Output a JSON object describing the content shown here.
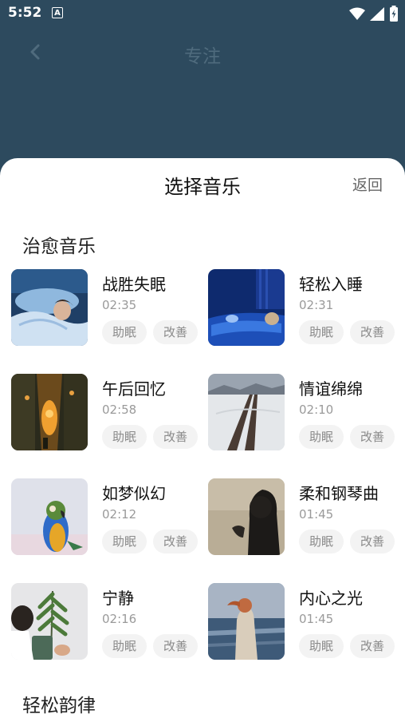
{
  "status": {
    "time": "5:52",
    "notif_badge": "A"
  },
  "header": {
    "title": "专注"
  },
  "sheet": {
    "title": "选择音乐",
    "back_label": "返回",
    "sections": [
      {
        "title": "治愈音乐",
        "tracks": [
          {
            "name": "战胜失眠",
            "duration": "02:35",
            "tags": [
              "助眠",
              "改善"
            ],
            "image": "person-in-bed"
          },
          {
            "name": "轻松入睡",
            "duration": "02:31",
            "tags": [
              "助眠",
              "改善"
            ],
            "image": "sleeping-blue-room"
          },
          {
            "name": "午后回忆",
            "duration": "02:58",
            "tags": [
              "助眠",
              "改善"
            ],
            "image": "lantern-alley"
          },
          {
            "name": "情谊绵绵",
            "duration": "02:10",
            "tags": [
              "助眠",
              "改善"
            ],
            "image": "snowy-road"
          },
          {
            "name": "如梦似幻",
            "duration": "02:12",
            "tags": [
              "助眠",
              "改善"
            ],
            "image": "parrot"
          },
          {
            "name": "柔和钢琴曲",
            "duration": "01:45",
            "tags": [
              "助眠",
              "改善"
            ],
            "image": "hooded-silhouette"
          },
          {
            "name": "宁静",
            "duration": "02:16",
            "tags": [
              "助眠",
              "改善"
            ],
            "image": "potted-plant"
          },
          {
            "name": "内心之光",
            "duration": "01:45",
            "tags": [
              "助眠",
              "改善"
            ],
            "image": "woman-at-sea"
          }
        ]
      },
      {
        "title": "轻松韵律",
        "tracks": []
      }
    ]
  },
  "colors": {
    "backdrop": "#2d4a5e",
    "sheet": "#ffffff",
    "tag_bg": "#f3f3f3",
    "muted_text": "#9a9a9a"
  }
}
